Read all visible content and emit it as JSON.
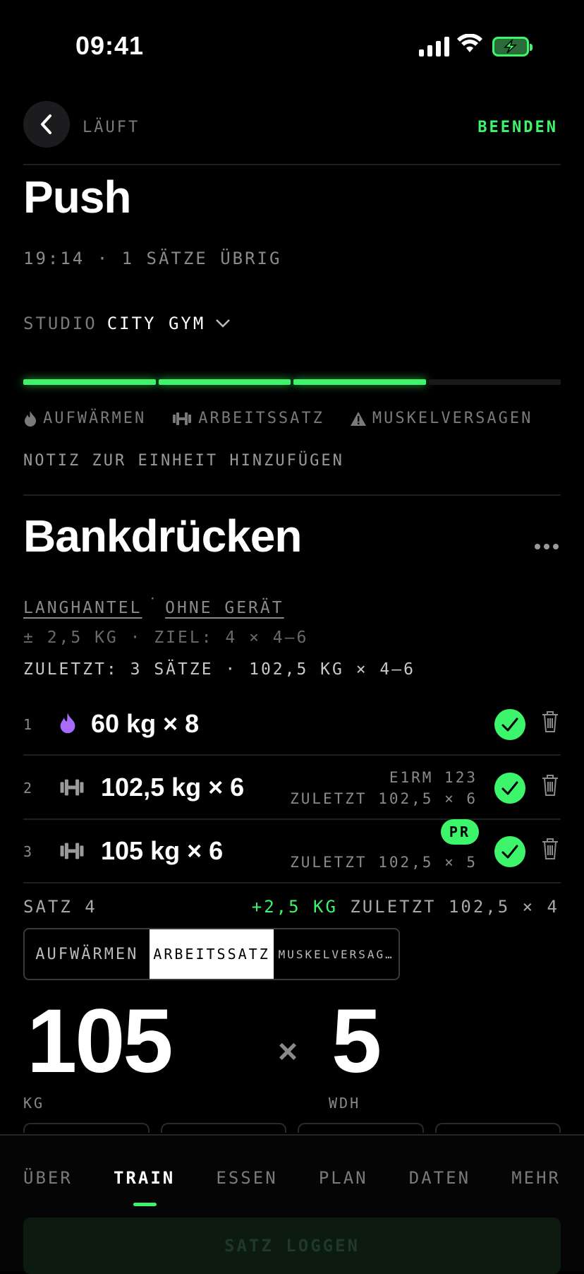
{
  "status_bar": {
    "time": "09:41"
  },
  "header": {
    "status": "LÄUFT",
    "finish_label": "BEENDEN"
  },
  "workout": {
    "title": "Push",
    "subtitle": "19:14 · 1 SÄTZE ÜBRIG",
    "gym_label": "STUDIO",
    "gym_value": "CITY GYM",
    "progress": {
      "completed_sets": 3,
      "total_sets": 4
    }
  },
  "legend": {
    "warmup": "AUFWÄRMEN",
    "working": "ARBEITSSATZ",
    "failure": "MUSKELVERSAGEN"
  },
  "note_label": "NOTIZ ZUR EINHEIT HINZUFÜGEN",
  "exercise": {
    "name": "Bankdrücken",
    "equipment_1": "LANGHANTEL",
    "equipment_sep": "·",
    "equipment_2": "OHNE GERÄT",
    "goal": "± 2,5 KG · ZIEL: 4 × 4–6",
    "last": "ZULETZT: 3 SÄTZE · 102,5 KG × 4–6"
  },
  "sets": [
    {
      "num": "1",
      "type_icon": "flame-icon",
      "value": "60 kg × 8",
      "meta1": "",
      "meta2": "",
      "badge": ""
    },
    {
      "num": "2",
      "type_icon": "dumbbell-icon",
      "value": "102,5 kg × 6",
      "meta1": "E1RM 123",
      "meta2": "ZULETZT 102,5 × 6",
      "badge": ""
    },
    {
      "num": "3",
      "type_icon": "dumbbell-icon",
      "value": "105 kg × 6",
      "meta1": "",
      "meta2": "ZULETZT 102,5 × 5",
      "badge": "PR"
    }
  ],
  "current_set": {
    "label": "SATZ 4",
    "delta": "+2,5 KG",
    "last": "ZULETZT 102,5 × 4",
    "types": [
      "AUFWÄRMEN",
      "ARBEITSSATZ",
      "MUSKELVERSAG…"
    ],
    "selected_type": "ARBEITSSATZ",
    "weight": "105",
    "times": "×",
    "reps": "5",
    "weight_unit": "KG",
    "reps_unit": "WDH"
  },
  "tabs": [
    {
      "label": "ÜBER",
      "active": false
    },
    {
      "label": "TRAIN",
      "active": true
    },
    {
      "label": "ESSEN",
      "active": false
    },
    {
      "label": "PLAN",
      "active": false
    },
    {
      "label": "DATEN",
      "active": false
    },
    {
      "label": "MEHR",
      "active": false
    }
  ],
  "log_button": "SATZ LOGGEN",
  "colors": {
    "accent": "#3df56a",
    "warmup": "#a66cff",
    "background": "#000000"
  }
}
